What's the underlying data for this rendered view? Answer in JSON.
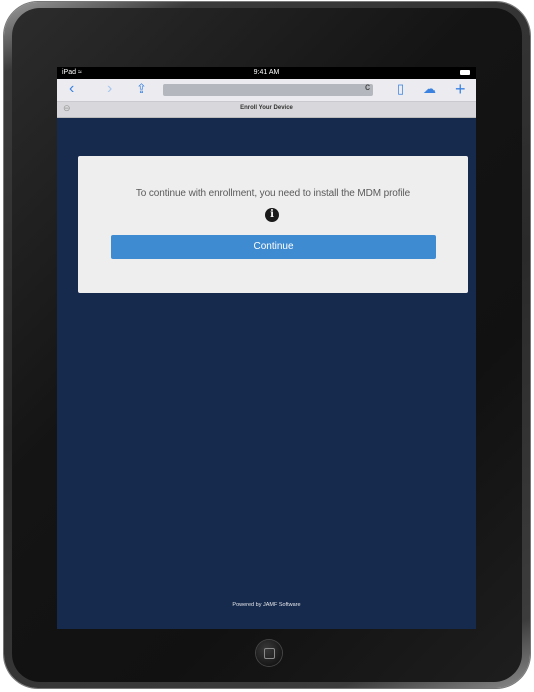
{
  "status_bar": {
    "carrier": "iPad ≈",
    "time": "9:41 AM"
  },
  "toolbar": {
    "back_icon": "‹",
    "forward_icon": "›",
    "share_icon": "⇪",
    "reload_icon": "c",
    "bookmarks_icon": "▯",
    "cloud_icon": "☁",
    "add_icon": "+"
  },
  "tab": {
    "title": "Enroll Your Device",
    "close_icon": "⊖"
  },
  "dialog": {
    "message": "To continue with enrollment, you need to install the MDM profile",
    "info_icon": "i",
    "continue_label": "Continue"
  },
  "footer": {
    "text": "Powered by JAMF Software"
  },
  "colors": {
    "page_background": "#162a4d",
    "button_blue": "#3f8bd2",
    "dialog_background": "#eeeeee",
    "toolbar_tint": "#3b82e0"
  }
}
